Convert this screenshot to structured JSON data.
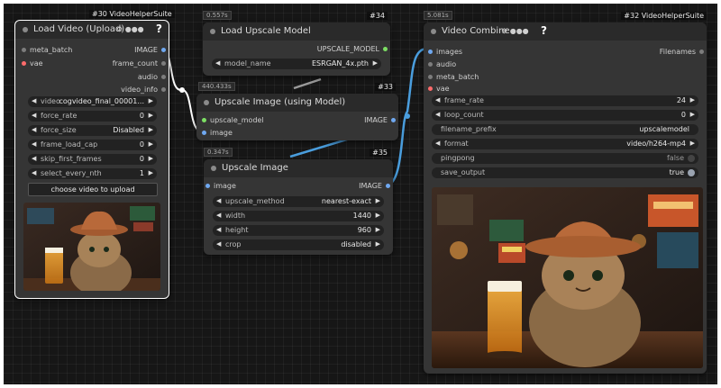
{
  "colors": {
    "canvas": "#161616",
    "node": "#353535",
    "title": "#2a2a2a",
    "widget": "#222222",
    "wire_image": "#4a9ede",
    "wire_model": "#9a9a9a",
    "slot_image": "#6fa8f0",
    "slot_model": "#7ddf64",
    "slot_vae": "#ff6b6b"
  },
  "nodes": {
    "load_video": {
      "id_tag": "#30 VideoHelperSuite",
      "title": "Load Video (Upload)",
      "controls_icons": [
        "gear-icon",
        "circle-icon",
        "circle-icon",
        "circle-icon"
      ],
      "help": "?",
      "inputs": [
        "meta_batch",
        "vae"
      ],
      "outputs": [
        "IMAGE",
        "frame_count",
        "audio",
        "video_info"
      ],
      "widgets": [
        {
          "label": "video",
          "value": "cogvideo_final_00001..."
        },
        {
          "label": "force_rate",
          "value": "0"
        },
        {
          "label": "force_size",
          "value": "Disabled"
        },
        {
          "label": "frame_load_cap",
          "value": "0"
        },
        {
          "label": "skip_first_frames",
          "value": "0"
        },
        {
          "label": "select_every_nth",
          "value": "1"
        }
      ],
      "button": "choose video to upload"
    },
    "load_upscale": {
      "time": "0.557s",
      "id_tag": "#34",
      "title": "Load Upscale Model",
      "outputs": [
        "UPSCALE_MODEL"
      ],
      "widgets": [
        {
          "label": "model_name",
          "value": "ESRGAN_4x.pth"
        }
      ]
    },
    "upscale_model": {
      "time": "440.433s",
      "id_tag": "#33",
      "title": "Upscale Image (using Model)",
      "inputs": [
        "upscale_model",
        "image"
      ],
      "outputs": [
        "IMAGE"
      ]
    },
    "upscale_image": {
      "time": "0.347s",
      "id_tag": "#35",
      "title": "Upscale Image",
      "inputs": [
        "image"
      ],
      "outputs": [
        "IMAGE"
      ],
      "widgets": [
        {
          "label": "upscale_method",
          "value": "nearest-exact"
        },
        {
          "label": "width",
          "value": "1440"
        },
        {
          "label": "height",
          "value": "960"
        },
        {
          "label": "crop",
          "value": "disabled"
        }
      ]
    },
    "video_combine": {
      "time": "5.081s",
      "id_tag": "#32 VideoHelperSuite",
      "title": "Video Combine",
      "controls_icons": [
        "gear-icon",
        "circle-icon",
        "circle-icon",
        "circle-icon"
      ],
      "help": "?",
      "inputs": [
        "images",
        "audio",
        "meta_batch",
        "vae"
      ],
      "outputs": [
        "Filenames"
      ],
      "widgets": [
        {
          "label": "frame_rate",
          "value": "24",
          "kind": "number"
        },
        {
          "label": "loop_count",
          "value": "0",
          "kind": "number"
        },
        {
          "label": "filename_prefix",
          "value": "upscalemodel",
          "kind": "text"
        },
        {
          "label": "format",
          "value": "video/h264-mp4",
          "kind": "combo"
        },
        {
          "label": "pingpong",
          "value": "false",
          "kind": "toggle"
        },
        {
          "label": "save_output",
          "value": "true",
          "kind": "toggle"
        }
      ]
    }
  }
}
